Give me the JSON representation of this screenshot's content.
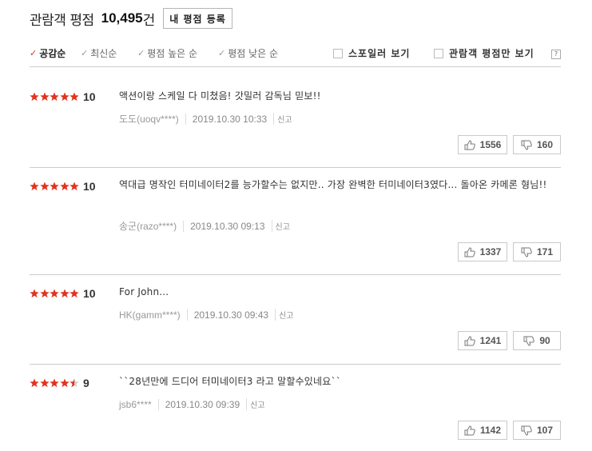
{
  "header": {
    "title": "관람객 평점",
    "count": "10,495",
    "unit": "건",
    "register_label": "내 평점 등록"
  },
  "sort_options": [
    {
      "label": "공감순",
      "active": true
    },
    {
      "label": "최신순",
      "active": false
    },
    {
      "label": "평점 높은 순",
      "active": false
    },
    {
      "label": "평점 낮은 순",
      "active": false
    }
  ],
  "filters": {
    "spoiler_label": "스포일러 보기",
    "audience_only_label": "관람객 평점만 보기",
    "help_label": "?"
  },
  "reviews": [
    {
      "rating": 10,
      "score": "10",
      "text": "액션이랑 스케일 다 미쳤음! 갓밀러 감독님 믿보!!",
      "user": "도도(uoqv****)",
      "date": "2019.10.30 10:33",
      "report": "신고",
      "likes": "1556",
      "dislikes": "160"
    },
    {
      "rating": 10,
      "score": "10",
      "text": "역대급 명작인 터미네이터2를 능가할수는 없지만.. 가장 완벽한 터미네이터3였다... 돌아온 카메론 형님!!",
      "user": "송군(razo****)",
      "date": "2019.10.30 09:13",
      "report": "신고",
      "likes": "1337",
      "dislikes": "171"
    },
    {
      "rating": 10,
      "score": "10",
      "text": "For John...",
      "user": "HK(gamm****)",
      "date": "2019.10.30 09:43",
      "report": "신고",
      "likes": "1241",
      "dislikes": "90"
    },
    {
      "rating": 9,
      "score": "9",
      "text": "``28년만에 드디어 터미네이터3 라고 말할수있네요``",
      "user": "jsb6****",
      "date": "2019.10.30 09:39",
      "report": "신고",
      "likes": "1142",
      "dislikes": "107"
    }
  ],
  "colors": {
    "star_on": "#e2331f",
    "star_off": "#cccccc",
    "accent": "#e2331f"
  }
}
